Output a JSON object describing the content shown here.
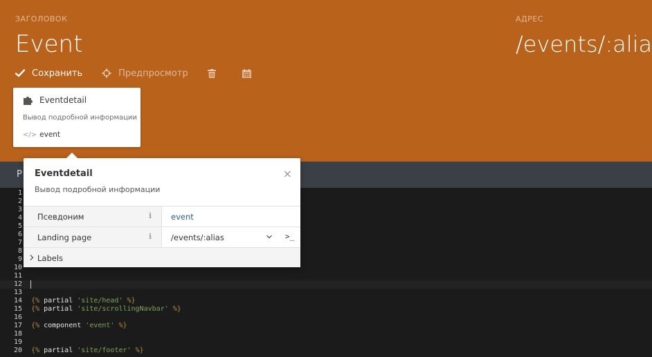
{
  "header": {
    "title_label": "ЗАГОЛОВОК",
    "title": "Event",
    "url_label": "АДРЕС",
    "url": "/events/:alias",
    "bg_color": "#b9621c"
  },
  "toolbar": {
    "save_label": "Сохранить",
    "preview_label": "Предпросмотр",
    "delete_icon": "trash-icon",
    "calendar_icon": "calendar-icon"
  },
  "component_card": {
    "name": "Eventdetail",
    "description": "Вывод подробной информации",
    "alias": "event",
    "icon": "puzzle-icon"
  },
  "strip": {
    "tab_letter": "Р"
  },
  "editor": {
    "lines": [
      {
        "num": "1"
      },
      {
        "num": "2"
      },
      {
        "num": "3"
      },
      {
        "num": "4"
      },
      {
        "num": "5"
      },
      {
        "num": "6"
      },
      {
        "num": "7"
      },
      {
        "num": "8"
      },
      {
        "num": "9"
      },
      {
        "num": "10"
      },
      {
        "num": "11"
      },
      {
        "num": "12"
      },
      {
        "num": "13"
      },
      {
        "num": "14",
        "open": "{%",
        "kw": "partial",
        "str": "'site/head'",
        "close": "%}"
      },
      {
        "num": "15",
        "open": "{%",
        "kw": "partial",
        "str": "'site/scrollingNavbar'",
        "close": "%}"
      },
      {
        "num": "16"
      },
      {
        "num": "17",
        "open": "{%",
        "kw": "component",
        "str": "'event'",
        "close": "%}"
      },
      {
        "num": "18"
      },
      {
        "num": "19"
      },
      {
        "num": "20",
        "open": "{%",
        "kw": "partial",
        "str": "'site/footer'",
        "close": "%}"
      }
    ]
  },
  "popup": {
    "title": "Eventdetail",
    "description": "Вывод подробной информации",
    "close_glyph": "×",
    "info_glyph": "i",
    "properties": [
      {
        "name": "Псевдоним",
        "value": "event"
      },
      {
        "name": "Landing page",
        "value": "/events/:alias",
        "terminal": ">_"
      }
    ],
    "labels_label": "Labels"
  }
}
